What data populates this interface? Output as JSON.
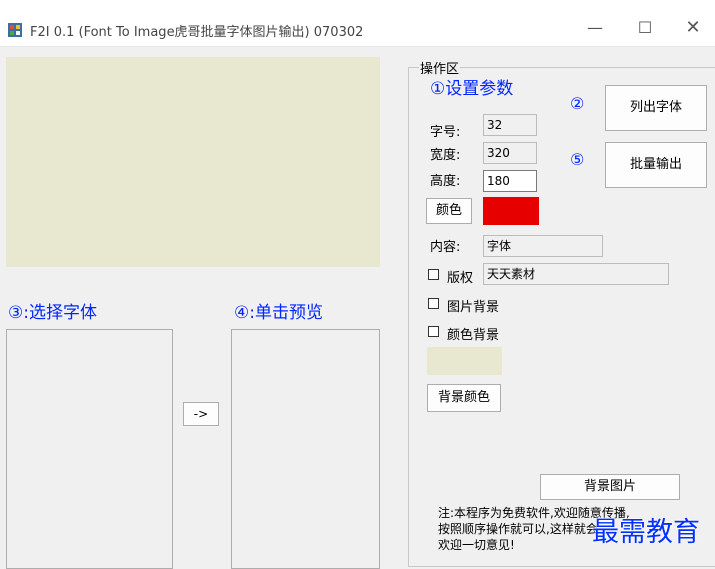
{
  "window": {
    "title": "F2I 0.1 (Font To Image虎哥批量字体图片输出)  070302",
    "icon": "app-window-icon",
    "minimize_glyph": "—",
    "maximize_glyph": "☐",
    "close_glyph": "✕"
  },
  "left": {
    "select_font_label": "③:选择字体",
    "preview_label": "④:单击预览",
    "arrow_button_label": "->"
  },
  "panel": {
    "group_title": "操作区",
    "settings_label": "①设置参数",
    "step2_marker": "②",
    "step5_marker": "⑤",
    "list_fonts_button": "列出字体",
    "batch_output_button": "批量输出",
    "font_size_label": "字号:",
    "font_size_value": "32",
    "width_label": "宽度:",
    "width_value": "320",
    "height_label": "高度:",
    "height_value": "180",
    "color_button": "颜色",
    "content_label": "内容:",
    "content_value": "字体",
    "copyright_label": "版权",
    "copyright_value": "天天素材",
    "copyright_checked": false,
    "image_bg_label": "图片背景",
    "image_bg_checked": false,
    "color_bg_label": "颜色背景",
    "color_bg_checked": false,
    "bg_color_button": "背景颜色",
    "bg_image_button": "背景图片",
    "note_lines": [
      "注:本程序为免费软件,欢迎随意传播,",
      "按照顺序操作就可以,这样就会",
      "欢迎一切意见!"
    ]
  },
  "colors": {
    "font_color": "#e60000",
    "background_color": "#e8e8d0",
    "accent": "#0026ff"
  },
  "watermark": "最需教育"
}
